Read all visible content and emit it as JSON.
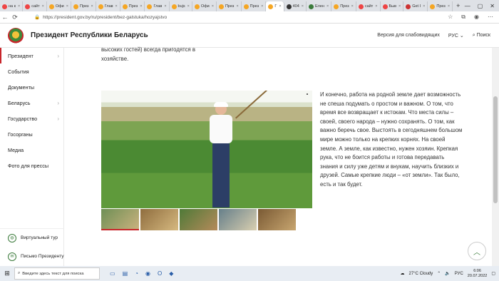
{
  "browser": {
    "tabs": [
      {
        "label": "на к",
        "color": "#e44"
      },
      {
        "label": "сайт",
        "color": "#e44"
      },
      {
        "label": "Офи",
        "color": "#f5a623"
      },
      {
        "label": "През",
        "color": "#f5a623"
      },
      {
        "label": "Глав",
        "color": "#f5a623"
      },
      {
        "label": "През",
        "color": "#f5a623"
      },
      {
        "label": "Глав",
        "color": "#f5a623"
      },
      {
        "label": "bujs",
        "color": "#f5a623"
      },
      {
        "label": "Офи",
        "color": "#f5a623"
      },
      {
        "label": "През",
        "color": "#f5a623"
      },
      {
        "label": "През",
        "color": "#f5a623"
      },
      {
        "label": "Г",
        "color": "#f5a623",
        "active": true
      },
      {
        "label": "404",
        "color": "#333"
      },
      {
        "label": "Елен",
        "color": "#3a7a3a"
      },
      {
        "label": "През",
        "color": "#f5a623"
      },
      {
        "label": "сайт",
        "color": "#e44"
      },
      {
        "label": "Быв",
        "color": "#e44"
      },
      {
        "label": "Get I",
        "color": "#c33"
      },
      {
        "label": "През",
        "color": "#f5a623"
      }
    ],
    "url": "https://president.gov.by/ru/president/bez-galstuka/hozyajstvo",
    "new_tab": "+"
  },
  "site": {
    "title": "Президент Республики Беларусь",
    "accessibility": "Версия для слабовидящих",
    "lang": "РУС",
    "search": "Поиск"
  },
  "sidebar": {
    "items": [
      {
        "label": "Президент",
        "active": true,
        "chevron": true
      },
      {
        "label": "События",
        "chevron": false
      },
      {
        "label": "Документы",
        "chevron": false
      },
      {
        "label": "Беларусь",
        "chevron": true
      },
      {
        "label": "Государство",
        "chevron": true
      },
      {
        "label": "Госорганы",
        "chevron": false
      },
      {
        "label": "Медиа",
        "chevron": false
      },
      {
        "label": "Фото для прессы",
        "chevron": false
      }
    ],
    "bottom": [
      {
        "label": "Виртуальный тур"
      },
      {
        "label": "Письмо Президенту"
      }
    ]
  },
  "content": {
    "intro": "высоких гостей) всегда пригодятся в хозяйстве.",
    "body": "И конечно, работа на родной земле дает возможность не спеша подумать о простом и важном. О том, что время все возвращает к истокам. Что места силы – своей, своего народа – нужно сохранять. О том, как важно беречь свое. Выстоять в сегодняшнем большом мире можно только на крепких корнях. На своей земле. А земле, как известно, нужен хозяин. Крепкая рука, что не боится работы и готова передавать знания и силу уже детям и внукам, научить близких и друзей. Самые крепкие люди – «от земли». Так было, есть и так будет."
  },
  "taskbar": {
    "search_placeholder": "Введите здесь текст для поиска",
    "weather": "27°C  Cloudy",
    "lang": "РУС",
    "time": "6:06",
    "date": "20.07.2022"
  }
}
